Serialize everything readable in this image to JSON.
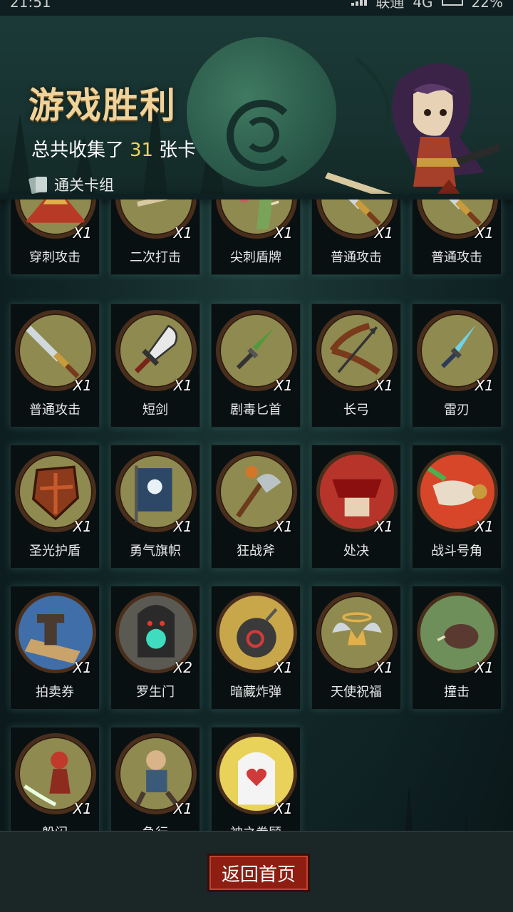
{
  "status_bar": {
    "time": "21:51",
    "carrier": "联通",
    "network": "4G",
    "battery": "22%"
  },
  "header": {
    "title": "游戏胜利",
    "summary_prefix": "总共收集了",
    "summary_count": "31",
    "summary_suffix": "张卡",
    "deck_label": "通关卡组"
  },
  "cards": [
    {
      "name": "穿刺攻击",
      "count": "X1",
      "icon": "spear-pierce-icon"
    },
    {
      "name": "二次打击",
      "count": "X1",
      "icon": "double-strike-icon"
    },
    {
      "name": "尖刺盾牌",
      "count": "X1",
      "icon": "spiked-shield-icon"
    },
    {
      "name": "普通攻击",
      "count": "X1",
      "icon": "sword-icon"
    },
    {
      "name": "普通攻击",
      "count": "X1",
      "icon": "sword-icon"
    },
    {
      "name": "普通攻击",
      "count": "X1",
      "icon": "sword-icon"
    },
    {
      "name": "短剑",
      "count": "X1",
      "icon": "short-sword-icon"
    },
    {
      "name": "剧毒匕首",
      "count": "X1",
      "icon": "poison-dagger-icon"
    },
    {
      "name": "长弓",
      "count": "X1",
      "icon": "longbow-icon"
    },
    {
      "name": "雷刃",
      "count": "X1",
      "icon": "thunder-blade-icon"
    },
    {
      "name": "圣光护盾",
      "count": "X1",
      "icon": "holy-shield-icon"
    },
    {
      "name": "勇气旗帜",
      "count": "X1",
      "icon": "banner-icon"
    },
    {
      "name": "狂战斧",
      "count": "X1",
      "icon": "battle-axe-icon"
    },
    {
      "name": "处决",
      "count": "X1",
      "icon": "execute-icon"
    },
    {
      "name": "战斗号角",
      "count": "X1",
      "icon": "war-horn-icon"
    },
    {
      "name": "拍卖券",
      "count": "X1",
      "icon": "auction-gavel-icon"
    },
    {
      "name": "罗生门",
      "count": "X2",
      "icon": "demon-gate-icon"
    },
    {
      "name": "暗藏炸弹",
      "count": "X1",
      "icon": "bomb-icon"
    },
    {
      "name": "天使祝福",
      "count": "X1",
      "icon": "angel-crown-icon"
    },
    {
      "name": "撞击",
      "count": "X1",
      "icon": "boar-charge-icon"
    },
    {
      "name": "躲闪",
      "count": "X1",
      "icon": "dodge-icon"
    },
    {
      "name": "急行",
      "count": "X1",
      "icon": "dash-icon"
    },
    {
      "name": "神之眷顾",
      "count": "X1",
      "icon": "angel-heart-icon"
    }
  ],
  "footer": {
    "back_label": "返回首页"
  },
  "colors": {
    "title": "#f0d39a",
    "count_highlight": "#f2d35c",
    "button": "#8e1d12",
    "card_art": "#8f8a4f"
  }
}
